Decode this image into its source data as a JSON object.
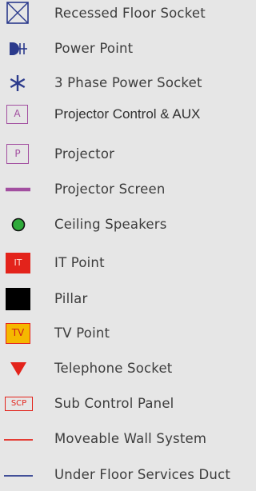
{
  "legend": {
    "items": [
      {
        "label": "Recessed Floor Socket",
        "icon": "recessed-floor-socket-icon",
        "color": "#2b3a8c"
      },
      {
        "label": "Power Point",
        "icon": "power-point-icon",
        "color": "#2b3a8c"
      },
      {
        "label": "3 Phase Power Socket",
        "icon": "three-phase-asterisk-icon",
        "color": "#2b3a8c"
      },
      {
        "label": "Projector Control & AUX",
        "icon": "projector-control-box-icon",
        "glyph": "A",
        "color": "#a24fa0"
      },
      {
        "label": "Projector",
        "icon": "projector-box-icon",
        "glyph": "P",
        "color": "#a24fa0"
      },
      {
        "label": "Projector Screen",
        "icon": "projector-screen-bar-icon",
        "color": "#a24fa0"
      },
      {
        "label": "Ceiling Speakers",
        "icon": "ceiling-speaker-circle-icon",
        "color": "#2faa3a"
      },
      {
        "label": "IT Point",
        "icon": "it-point-box-icon",
        "glyph": "IT",
        "color": "#e3231b"
      },
      {
        "label": "Pillar",
        "icon": "pillar-square-icon",
        "color": "#000000"
      },
      {
        "label": "TV Point",
        "icon": "tv-point-box-icon",
        "glyph": "TV",
        "color": "#f5b800"
      },
      {
        "label": "Telephone Socket",
        "icon": "telephone-triangle-icon",
        "color": "#e3231b"
      },
      {
        "label": "Sub Control Panel",
        "icon": "sub-control-panel-box-icon",
        "glyph": "SCP",
        "color": "#e3231b"
      },
      {
        "label": "Moveable Wall System",
        "icon": "moveable-wall-line-icon",
        "color": "#e3231b"
      },
      {
        "label": "Under Floor Services Duct",
        "icon": "under-floor-duct-line-icon",
        "color": "#2b3a8c"
      }
    ]
  }
}
